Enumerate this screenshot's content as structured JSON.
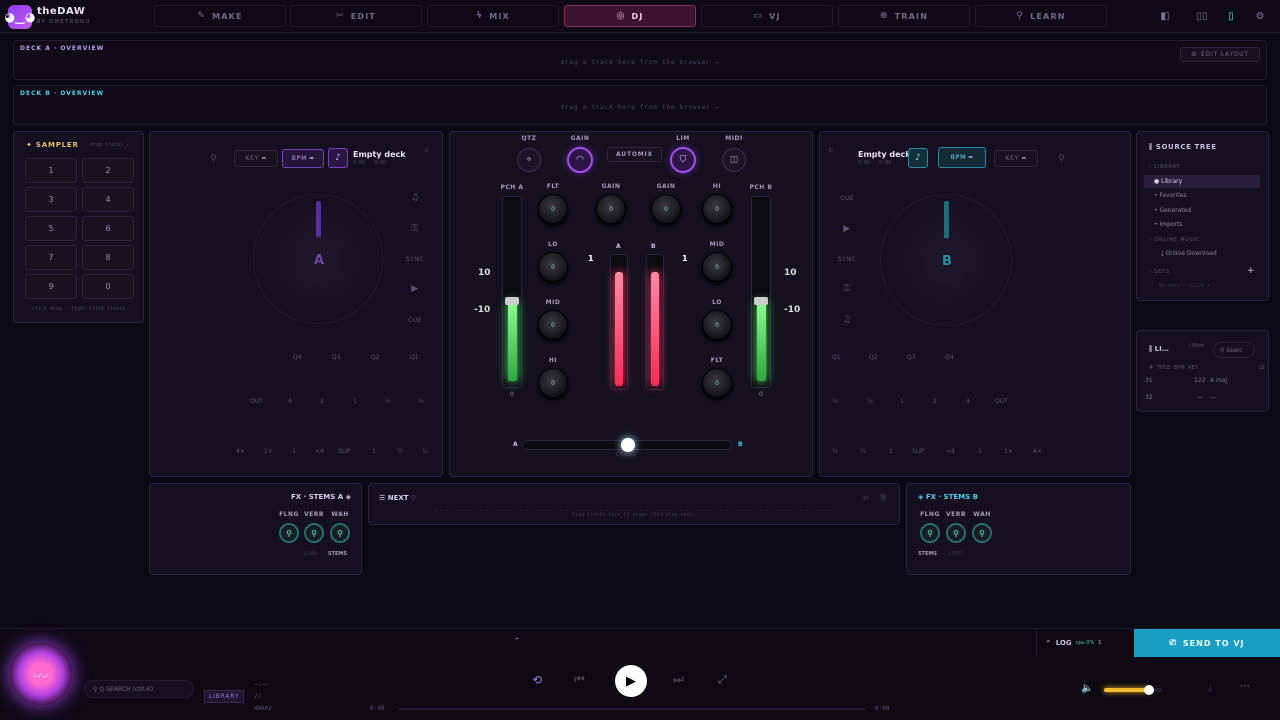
{
  "app": {
    "name": "theDAW",
    "subtitle": "BY OMETRONO"
  },
  "nav": {
    "tabs": [
      {
        "label": "MAKE",
        "icon": "✎"
      },
      {
        "label": "EDIT",
        "icon": "✂"
      },
      {
        "label": "MIX",
        "icon": "ϟ"
      },
      {
        "label": "DJ",
        "icon": "◎"
      },
      {
        "label": "VJ",
        "icon": "▭"
      },
      {
        "label": "TRAIN",
        "icon": "⊕"
      },
      {
        "label": "LEARN",
        "icon": "⚲"
      }
    ],
    "active": "DJ"
  },
  "overview_a": {
    "label": "DECK A · OVERVIEW",
    "hint": "drag a track here from the browser →",
    "edit_layout": "EDIT LAYOUT"
  },
  "overview_b": {
    "label": "DECK B · OVERVIEW",
    "hint": "drag a track here from the browser →"
  },
  "sampler": {
    "title": "SAMPLER",
    "hint": "drag tracks ↓",
    "pads": [
      "1",
      "2",
      "3",
      "4",
      "5",
      "6",
      "7",
      "8",
      "9",
      "0"
    ],
    "footer": "click drag · right-click clears"
  },
  "deck_a": {
    "key": "KEY",
    "bpm": "BPM",
    "title": "Empty deck",
    "time": "0:00 · 0:00",
    "letter": "A",
    "sync": "SYNC",
    "cue": "CUE",
    "hotcues": [
      "Q4",
      "Q3",
      "Q2",
      "Q1"
    ],
    "loops": [
      "OUT",
      "4",
      "2",
      "1",
      "½",
      "¼"
    ],
    "row3": [
      "4×",
      "1×",
      "-1",
      "<4",
      "SLIP",
      "1",
      "½",
      "¼"
    ]
  },
  "deck_b": {
    "key": "KEY",
    "bpm": "BPM",
    "title": "Empty deck",
    "time": "0:00 · 0:00",
    "letter": "B",
    "sync": "SYNC",
    "cue": "CUE",
    "hotcues": [
      "Q1",
      "Q2",
      "Q3",
      "Q4"
    ],
    "loops": [
      "¼",
      "½",
      "1",
      "2",
      "4",
      "OUT"
    ],
    "row3": [
      "¼",
      "½",
      "1",
      "SLIP",
      "<4",
      "-1",
      "1×",
      "4×"
    ]
  },
  "mixer": {
    "top": {
      "qtz": "QTZ",
      "gain": "GAIN",
      "automix": "AUTOMIX",
      "lim": "LIM",
      "midi": "MIDI"
    },
    "pch_a": "PCH A",
    "pch_b": "PCH B",
    "col_a": {
      "flt": "FLT",
      "gain": "GAIN",
      "lo": "LO",
      "mid": "MID",
      "hi": "HI"
    },
    "col_b": {
      "gain": "GAIN",
      "hi": "HI",
      "mid": "MID",
      "lo": "LO",
      "flt": "FLT"
    },
    "knob_value": "0",
    "scale_top": "10",
    "scale_mid": "-10",
    "ch_a": "A",
    "ch_b": "B",
    "ch_value": "1",
    "pitch_value": "0",
    "cross_a": "A",
    "cross_b": "B",
    "cross_label": "CROSS",
    "crossfader": 0.5,
    "pitch_a_level": 0.45,
    "pitch_b_level": 0.45,
    "vol_a_level": 0.88,
    "vol_b_level": 0.88
  },
  "fx_a": {
    "title": "FX · STEMS A",
    "knobs": [
      "FLNG",
      "VERB",
      "WAH"
    ],
    "tabs": [
      "LOAD",
      "STEMS"
    ]
  },
  "fx_b": {
    "title": "FX · STEMS B",
    "knobs": [
      "FLNG",
      "VERB",
      "WAH"
    ],
    "tabs": [
      "STEMS",
      "LOAD"
    ]
  },
  "next": {
    "title": "NEXT",
    "count": "0",
    "hint": "Drag tracks here to stage them play-next…"
  },
  "source_tree": {
    "title": "SOURCE TREE",
    "library": "LIBRARY",
    "items": [
      "Library",
      "Favorites",
      "Generated",
      "Imports"
    ],
    "online": "ONLINE MUSIC",
    "online_item": "Online Download",
    "sets": "SETS",
    "sets_hint": "No sets — click +"
  },
  "library_panel": {
    "title": "LI…",
    "sub": "/ filter",
    "search": "searc",
    "cols": [
      "#",
      "TITLE",
      "BPM",
      "KEY",
      "LE"
    ],
    "rows": [
      {
        "n": "31",
        "bpm": "122",
        "key": "A maj"
      },
      {
        "n": "32",
        "bpm": "—",
        "key": "—"
      }
    ]
  },
  "bottom": {
    "search": "Q-SEARCH (ctrl-K)",
    "library_badge": "LIBRARY",
    "meta1": "—:——",
    "meta2": "//",
    "meta3": "48kHz",
    "time_start": "0:00",
    "time_end": "0:00",
    "log": "LOG",
    "log_cpu": "cpu 0%",
    "log_n": "1",
    "send": "SEND TO VJ",
    "volume": 0.78
  },
  "colors": {
    "accent": "#a24ee8",
    "pink": "#ff3d6b",
    "green": "#5cf06a",
    "cyan": "#2ec8e8",
    "deck_a": "#8b3df5",
    "deck_b": "#2ec8e8"
  }
}
